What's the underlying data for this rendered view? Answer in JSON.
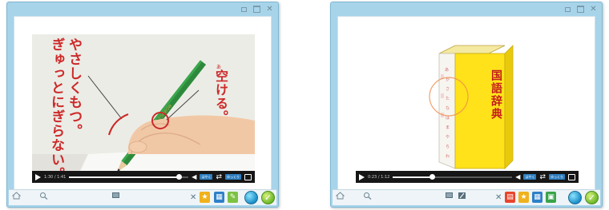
{
  "left_window": {
    "window_controls": [
      "restore",
      "pin",
      "close"
    ],
    "video": {
      "caption_main": "やさしくもつ。",
      "caption_sub": "ぎゅっとにぎらない。",
      "caption_right": "空ける。",
      "caption_right_small": "あ",
      "time": "1:30 / 1:41",
      "progress": 0.92,
      "buttons": [
        "はやく",
        "ゆっくり"
      ]
    },
    "bottombar": {
      "left_items": [
        "home",
        "zoom",
        "blackboard"
      ],
      "tools": [
        "close",
        "tool-1",
        "tool-2",
        "tool-3",
        "globe",
        "check"
      ]
    }
  },
  "right_window": {
    "window_controls": [
      "restore",
      "pin",
      "close"
    ],
    "video": {
      "book_title": "国語辞典",
      "spine_text": "あ か さ た な は ま や ら わ",
      "time": "0:23 / 1:12",
      "progress": 0.33,
      "buttons": [
        "はやく",
        "ゆっくり"
      ]
    },
    "bottombar": {
      "left_items": [
        "home",
        "zoom",
        "blackboard",
        "pen"
      ],
      "tools": [
        "close",
        "tool-red",
        "tool-1",
        "tool-2",
        "tool-green",
        "globe",
        "check"
      ]
    }
  },
  "colors": {
    "frame": "#a8d4ea",
    "caption_red": "#cc2a2a",
    "book_yellow": "#ffe21a",
    "controls_bg": "#161616"
  }
}
